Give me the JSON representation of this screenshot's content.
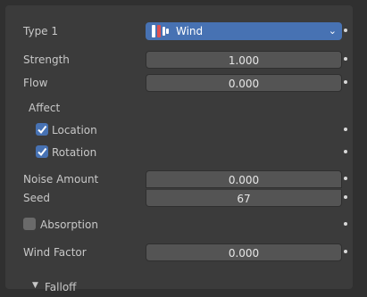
{
  "type_row": {
    "label": "Type 1",
    "value": "Wind",
    "icon": "wind-force-icon"
  },
  "strength": {
    "label": "Strength",
    "value": "1.000"
  },
  "flow": {
    "label": "Flow",
    "value": "0.000"
  },
  "affect": {
    "label": "Affect",
    "location": {
      "label": "Location",
      "checked": true
    },
    "rotation": {
      "label": "Rotation",
      "checked": true
    }
  },
  "noise_amount": {
    "label": "Noise Amount",
    "value": "0.000"
  },
  "seed": {
    "label": "Seed",
    "value": "67"
  },
  "absorption": {
    "label": "Absorption",
    "checked": false
  },
  "wind_factor": {
    "label": "Wind Factor",
    "value": "0.000"
  },
  "falloff": {
    "label": "Falloff",
    "expanded": false
  },
  "colors": {
    "accent": "#4772b3",
    "field": "#545454",
    "panel": "#3b3b3b"
  }
}
